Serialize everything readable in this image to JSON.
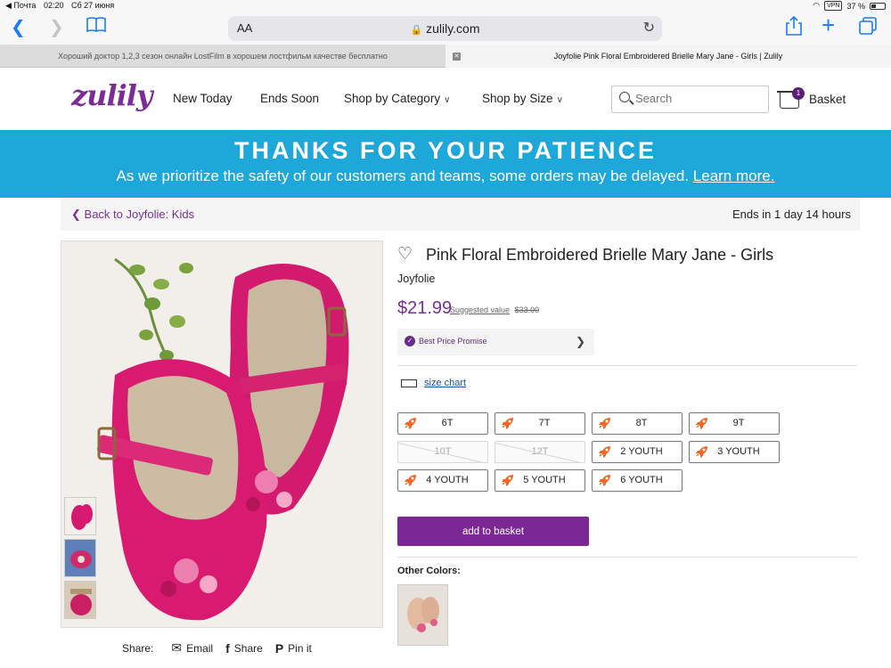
{
  "status_bar": {
    "app": "◀ Почта",
    "time": "02:20",
    "date": "Сб 27 июня",
    "vpn": "VPN",
    "battery": "37 %"
  },
  "browser": {
    "text_size_label": "AA",
    "url": "zulily.com",
    "tabs": [
      {
        "title": "Хороший доктор 1,2,3 сезон онлайн LostFilm в хорошем лостфильм качестве бесплатно"
      },
      {
        "title": "Joyfolie Pink Floral Embroidered Brielle Mary Jane - Girls | Zulily"
      }
    ]
  },
  "header": {
    "logo": "zulily",
    "nav": [
      {
        "label": "New Today"
      },
      {
        "label": "Ends Soon"
      },
      {
        "label": "Shop by Category"
      },
      {
        "label": "Shop by Size"
      }
    ],
    "search_placeholder": "Search",
    "basket_label": "Basket",
    "basket_count": "1"
  },
  "banner": {
    "title": "THANKS FOR YOUR PATIENCE",
    "message": "As we prioritize the safety of our customers and teams, some orders may be delayed.",
    "link": "Learn more."
  },
  "breadcrumb": {
    "back_label": "Back to Joyfolie: Kids",
    "ends": "Ends in 1 day 14 hours"
  },
  "product": {
    "title": "Pink Floral Embroidered Brielle Mary Jane - Girls",
    "brand": "Joyfolie",
    "price": "$21.99",
    "suggested_label": "Suggested value",
    "suggested_price": "$33.00",
    "promise": "Best Price Promise",
    "size_chart": "size chart",
    "sizes": [
      {
        "label": "6T",
        "available": true
      },
      {
        "label": "7T",
        "available": true
      },
      {
        "label": "8T",
        "available": true
      },
      {
        "label": "9T",
        "available": true
      },
      {
        "label": "10T",
        "available": false
      },
      {
        "label": "12T",
        "available": false
      },
      {
        "label": "2 YOUTH",
        "available": true
      },
      {
        "label": "3 YOUTH",
        "available": true
      },
      {
        "label": "4 YOUTH",
        "available": true
      },
      {
        "label": "5 YOUTH",
        "available": true
      },
      {
        "label": "6 YOUTH",
        "available": true
      }
    ],
    "add_to_basket": "add to basket",
    "other_colors": "Other Colors:"
  },
  "share": {
    "label": "Share:",
    "email": "Email",
    "facebook": "Share",
    "pinterest": "Pin it"
  },
  "colors": {
    "purple": "#7b2894",
    "banner": "#1ea7d9",
    "ios_blue": "#1a7cf4",
    "rocket": "#f26522"
  }
}
